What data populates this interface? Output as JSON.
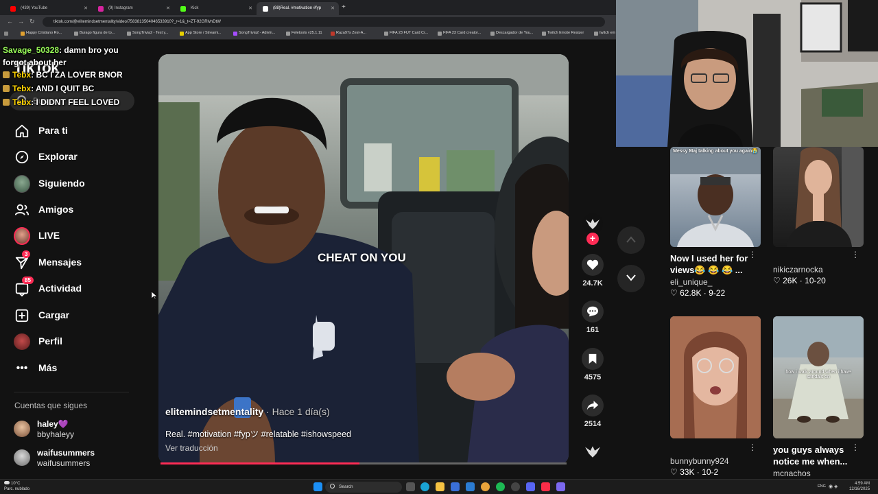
{
  "browser": {
    "tabs": [
      {
        "label": "(439) YouTube",
        "color": "#ff0000"
      },
      {
        "label": "(9) Instagram",
        "color": "#d6249f"
      },
      {
        "label": "Kick",
        "color": "#53fc18"
      },
      {
        "label": "(88)Real. #motivation #fyp",
        "color": "#ffffff"
      }
    ],
    "url": "tiktok.com/@elitemindsetmentality/video/7583813504046533910?_r=1&_t=ZT-92GRlvhDtW",
    "bookmarks": [
      "Happy Cristiano Ro...",
      "Burago figura de to...",
      "SongTrivia2 - Test y...",
      "App Store / Streami...",
      "SongTrivia2 - Adivin...",
      "Feletools v25.1.11",
      "Raza97s Zest-A...",
      "FIFA 23 FUT Card Cr...",
      "FIFA 23 Card creator...",
      "Descargador de You...",
      "Twitch Emote Resizer",
      "twitch em"
    ]
  },
  "tiktok": {
    "logo": "TikTok",
    "search_placeholder": "Buscar",
    "nav": [
      {
        "label": "Para ti",
        "icon": "home-icon"
      },
      {
        "label": "Explorar",
        "icon": "compass-icon"
      },
      {
        "label": "Siguiendo",
        "icon": "following-avatar-icon"
      },
      {
        "label": "Amigos",
        "icon": "friends-icon"
      },
      {
        "label": "LIVE",
        "icon": "live-avatar-icon"
      },
      {
        "label": "Mensajes",
        "icon": "send-icon",
        "badge": "3"
      },
      {
        "label": "Actividad",
        "icon": "inbox-icon",
        "badge": "85"
      },
      {
        "label": "Cargar",
        "icon": "upload-icon"
      },
      {
        "label": "Perfil",
        "icon": "profile-avatar-icon"
      },
      {
        "label": "Más",
        "icon": "more-icon"
      }
    ],
    "following_title": "Cuentas que sigues",
    "following": [
      {
        "name": "haley💜",
        "handle": "bbyhaleyy"
      },
      {
        "name": "waifusummers",
        "handle": "waifusummers"
      }
    ],
    "video": {
      "overlay_text": "CHEAT ON YOU",
      "author": "elitemindsetmentality",
      "time": " · Hace 1 día(s)",
      "description": "Real. #motivation #fypツ #relatable #ishowspeed",
      "translate": "Ver traducción",
      "progress": 0.49
    },
    "actions": {
      "likes": "24.7K",
      "comments": "161",
      "saves": "4575",
      "shares": "2514"
    },
    "grid": [
      {
        "overlay": "Messy Maj talking about you again😭",
        "title": "Now I used her for views😂 😂 😂 ...",
        "user": "eli_unique_",
        "likes": "62.8K",
        "date": "9-22"
      },
      {
        "overlay": "",
        "title": "",
        "user": "nikiczarnocka",
        "likes": "26K",
        "date": "10-20"
      },
      {
        "overlay": "",
        "title": "",
        "user": "bunnybunny924",
        "likes": "33K",
        "date": "10-2"
      },
      {
        "overlay": "how i walk around when i have sandals on",
        "title": "you guys always notice me when...",
        "user": "mcnachos",
        "likes": "",
        "date": ""
      }
    ]
  },
  "chat": [
    {
      "user": "Savage_50328",
      "message": ": damn bro you forgot about her",
      "color": "#9bff5a",
      "badge": false
    },
    {
      "user": "Tebx",
      "message": ": BC I ZA LOVER BNOR",
      "color": "#ffd400",
      "badge": true
    },
    {
      "user": "Tebx",
      "message": ": AND I QUIT BC",
      "color": "#ffd400",
      "badge": true
    },
    {
      "user": "Tebx",
      "message": ": I DIDNT FEEL LOVED",
      "color": "#ffd400",
      "badge": true
    }
  ],
  "taskbar": {
    "temp": "10°C",
    "weather": "Parc. nublado",
    "search": "Search",
    "lang": "ENG",
    "time": "4:59 AM",
    "date": "12/16/2025"
  }
}
